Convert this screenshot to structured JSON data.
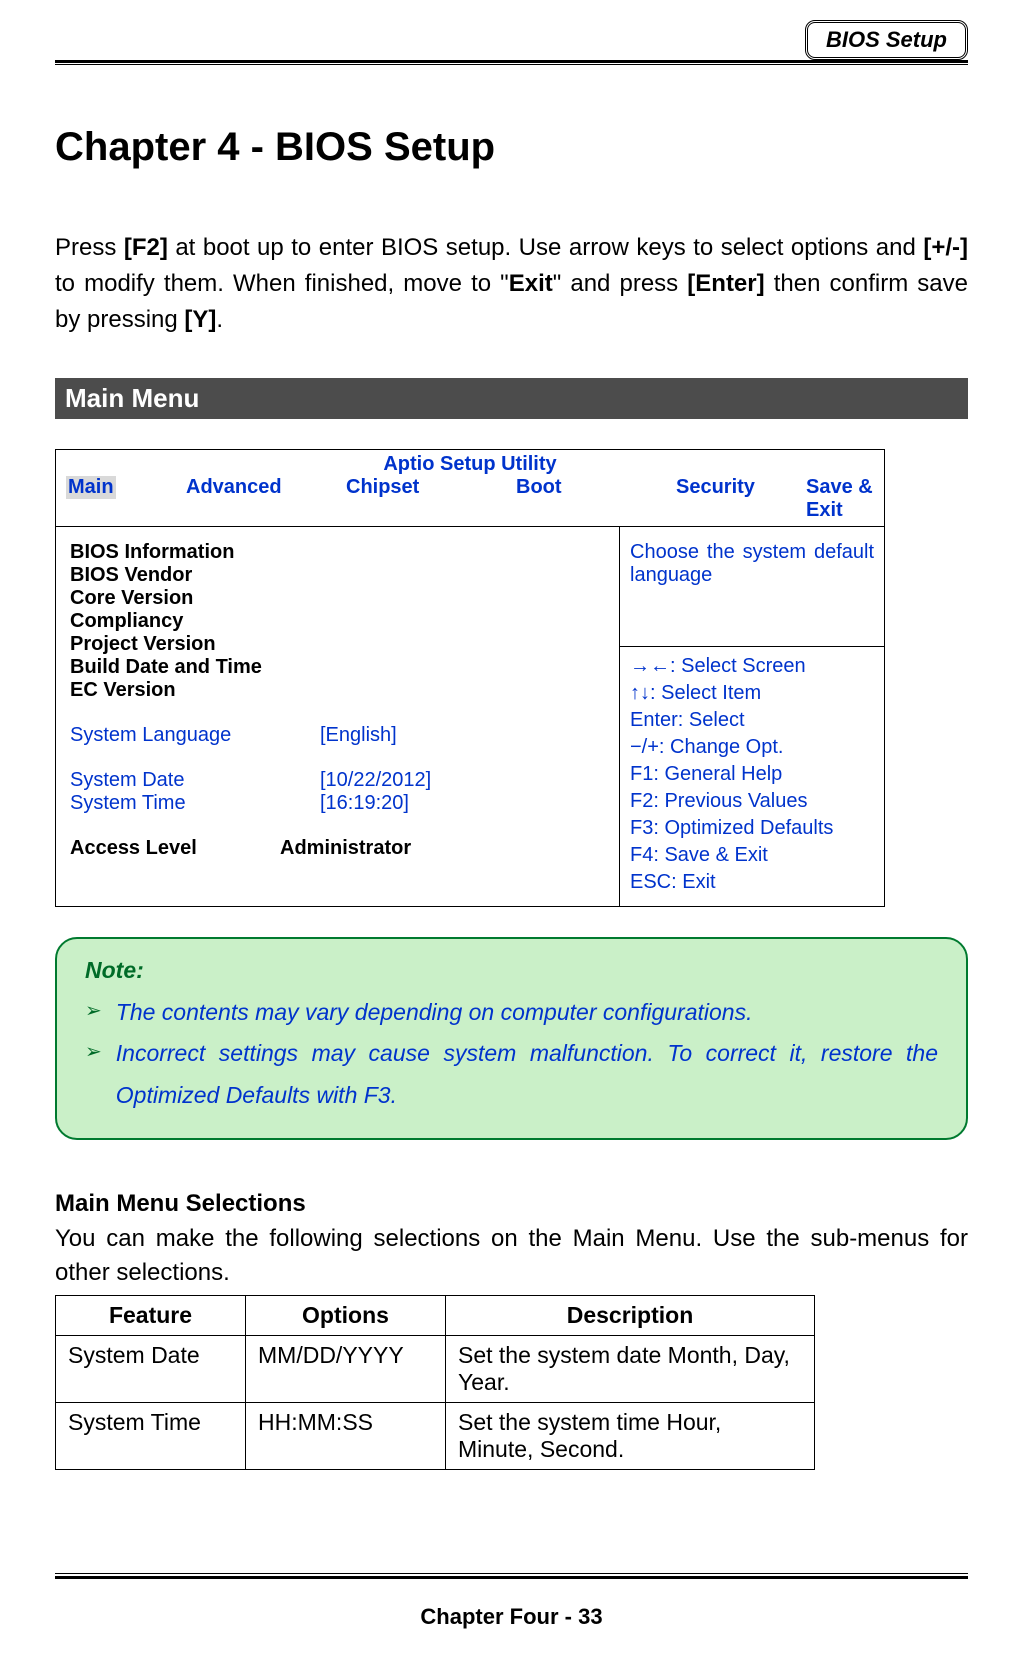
{
  "header": {
    "badge": "BIOS Setup"
  },
  "title": "Chapter 4 - BIOS Setup",
  "intro": {
    "t1": "Press ",
    "k1": "[F2]",
    "t2": " at boot up to enter BIOS setup. Use arrow keys to select options and ",
    "k2": "[+/-]",
    "t3": " to modify them. When finished, move to \"",
    "k3": "Exit",
    "t4": "\" and press ",
    "k4": "[Enter]",
    "t5": " then confirm save by pressing ",
    "k5": "[Y]",
    "t6": "."
  },
  "section_bar": "Main Menu",
  "aptio": {
    "title": "Aptio Setup Utility",
    "tabs": {
      "main": "Main",
      "advanced": "Advanced",
      "chipset": "Chipset",
      "boot": "Boot",
      "security": "Security",
      "save": "Save & Exit"
    },
    "left": {
      "lines": {
        "l0": "BIOS Information",
        "l1": "BIOS Vendor",
        "l2": "Core Version",
        "l3": "Compliancy",
        "l4": "Project Version",
        "l5": "Build Date and Time",
        "l6": "EC Version"
      },
      "sys_lang_label": "System Language",
      "sys_lang_value": "[English]",
      "sys_date_label": "System Date",
      "sys_date_value": "[10/22/2012]",
      "sys_time_label": "System Time",
      "sys_time_value": "[16:19:20]",
      "access_label": "Access Level",
      "access_value": "Administrator"
    },
    "help": "Choose the system default language",
    "keys": {
      "k0": "→←: Select Screen",
      "k1": "↑↓: Select Item",
      "k2": "Enter: Select",
      "k3": "−/+: Change Opt.",
      "k4": "F1: General Help",
      "k5": "F2: Previous Values",
      "k6": "F3: Optimized Defaults",
      "k7": "F4: Save & Exit",
      "k8": "ESC: Exit"
    }
  },
  "note": {
    "title": "Note:",
    "items": {
      "i0": "The contents may vary depending on computer configurations.",
      "i1": "Incorrect settings may cause system malfunction. To correct it, restore the Optimized Defaults with F3."
    }
  },
  "subsection": {
    "title": "Main Menu Selections",
    "intro": "You can make the following selections on the Main Menu. Use the sub-menus for other selections."
  },
  "sel_table": {
    "headers": {
      "feature": "Feature",
      "options": "Options",
      "description": "Description"
    },
    "rows": [
      {
        "feature": "System Date",
        "options": "MM/DD/YYYY",
        "description": "Set the system date Month, Day, Year."
      },
      {
        "feature": "System Time",
        "options": "HH:MM:SS",
        "description": "Set the system time Hour, Minute, Second."
      }
    ]
  },
  "footer": "Chapter Four - 33"
}
